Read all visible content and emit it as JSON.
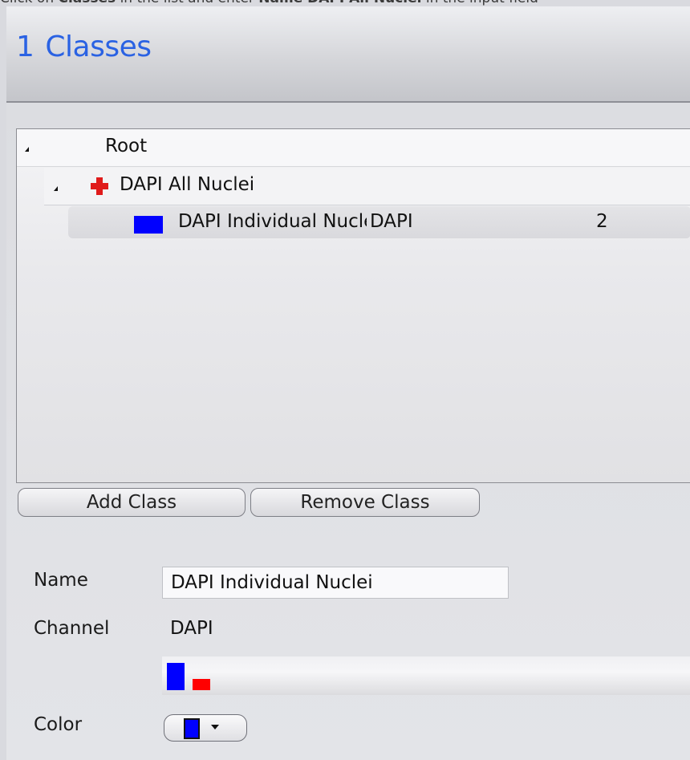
{
  "instruction": {
    "part1": "Click on ",
    "bold1": "Classes",
    "part2": " in the list and enter ",
    "bold2": "Name DAPI All Nuclei",
    "part3": " in the input field"
  },
  "header": {
    "number": "1",
    "title": "Classes"
  },
  "tree": {
    "root_label": "Root",
    "items": [
      {
        "label": "DAPI All Nuclei",
        "icon": "red-cross-icon"
      },
      {
        "label": "DAPI Individual Nuclei",
        "channel": "DAPI",
        "count": "2",
        "color": "#0000ff"
      }
    ]
  },
  "buttons": {
    "add_label": "Add Class",
    "remove_label": "Remove Class"
  },
  "form": {
    "name_label": "Name",
    "name_value": "DAPI Individual Nuclei",
    "channel_label": "Channel",
    "channel_value": "DAPI",
    "color_label": "Color",
    "color_value": "#0000ff"
  },
  "colors": {
    "accent": "#2a62e3",
    "blue": "#0000ff",
    "red": "#ff0000",
    "cross": "#e01b1b"
  }
}
